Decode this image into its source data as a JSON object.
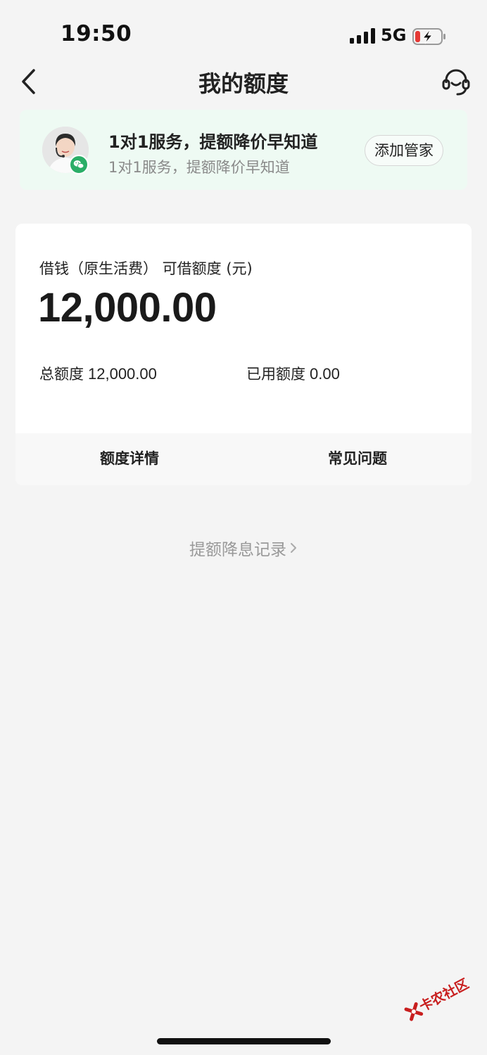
{
  "status_bar": {
    "time": "19:50",
    "network": "5G"
  },
  "nav": {
    "title": "我的额度",
    "back_icon": "chevron-left-icon",
    "service_icon": "headset-icon"
  },
  "banner": {
    "title": "1对1服务，提额降价早知道",
    "subtitle": "1对1服务，提额降价早知道",
    "button_label": "添加管家",
    "avatar_icon": "agent-avatar",
    "badge_icon": "wechat-icon"
  },
  "quota": {
    "label": "借钱（原生活费） 可借额度 (元)",
    "available": "12,000.00",
    "total_label": "总额度",
    "total_value": "12,000.00",
    "used_label": "已用额度",
    "used_value": "0.00",
    "details_label": "额度详情",
    "faq_label": "常见问题"
  },
  "record_link": {
    "label": "提额降息记录"
  },
  "watermark": {
    "text": "卡农社区"
  },
  "colors": {
    "background": "#f4f4f4",
    "banner_bg": "#eefaf3",
    "accent_green": "#2aae67",
    "battery_low": "#e53935"
  }
}
